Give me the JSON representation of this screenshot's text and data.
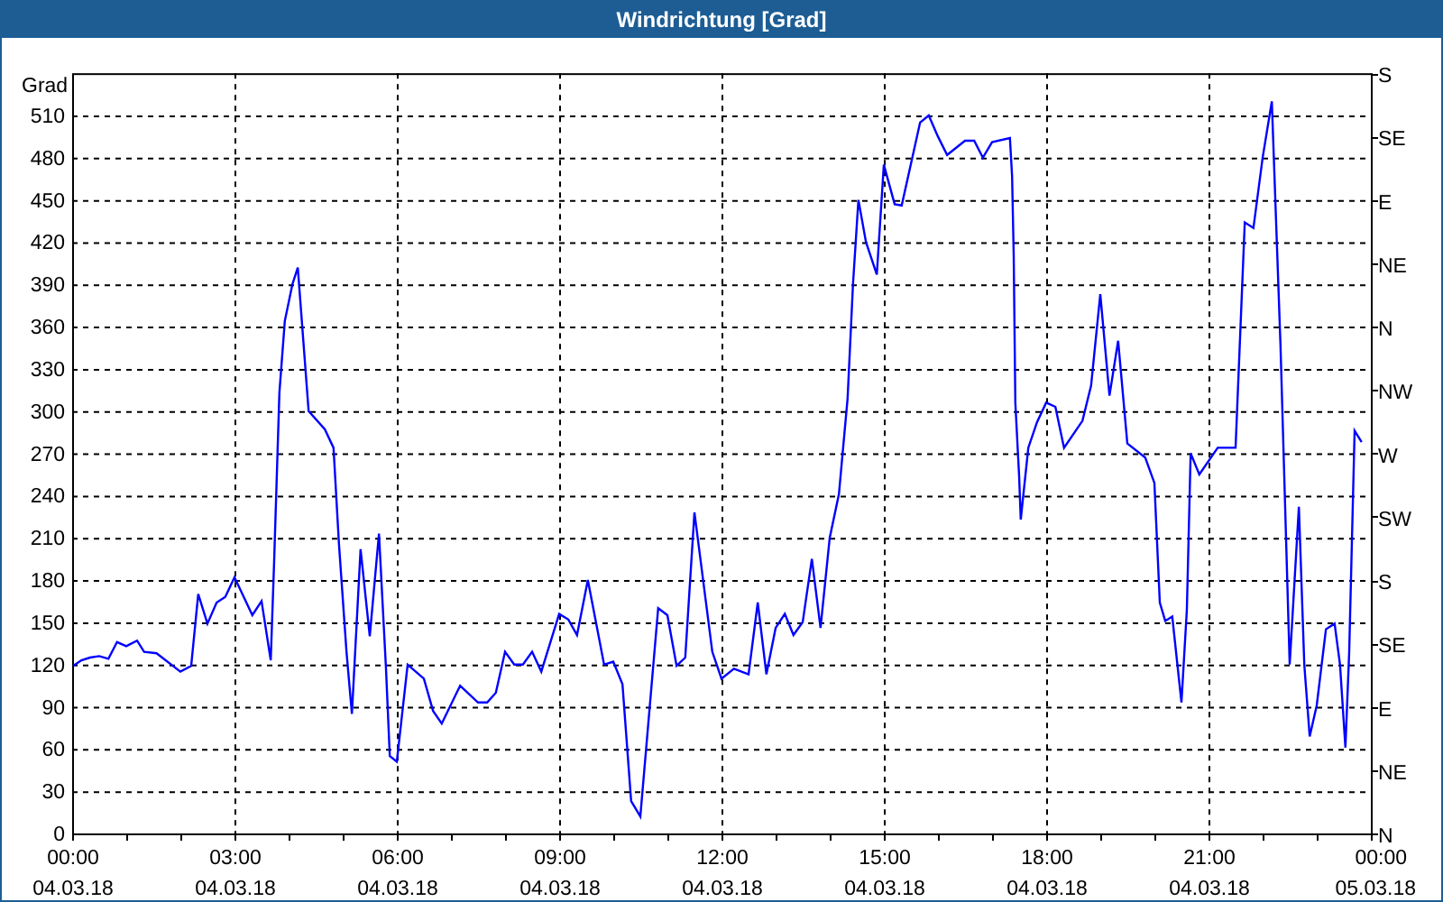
{
  "window": {
    "title": "Windrichtung [Grad]"
  },
  "chart": {
    "chart_data": {
      "type": "line",
      "grid": true,
      "ylabel": "Grad",
      "xlim": [
        0,
        24
      ],
      "ylim": [
        0,
        540
      ],
      "yticks": [
        0,
        30,
        60,
        90,
        120,
        150,
        180,
        210,
        240,
        270,
        300,
        330,
        360,
        390,
        420,
        450,
        480,
        510
      ],
      "xticks": [
        {
          "value": 0,
          "label": "00:00"
        },
        {
          "value": 3,
          "label": "03:00"
        },
        {
          "value": 6,
          "label": "06:00"
        },
        {
          "value": 9,
          "label": "09:00"
        },
        {
          "value": 12,
          "label": "12:00"
        },
        {
          "value": 15,
          "label": "15:00"
        },
        {
          "value": 18,
          "label": "18:00"
        },
        {
          "value": 21,
          "label": "21:00"
        },
        {
          "value": 24,
          "label": "00:00"
        }
      ],
      "x": [
        0.02,
        0.17,
        0.33,
        0.5,
        0.67,
        0.83,
        1.0,
        1.2,
        1.33,
        1.56,
        2.0,
        2.2,
        2.33,
        2.5,
        2.67,
        2.83,
        3.0,
        3.33,
        3.5,
        3.67,
        3.73,
        3.83,
        3.93,
        4.07,
        4.17,
        4.37,
        4.67,
        4.83,
        4.93,
        5.07,
        5.17,
        5.33,
        5.5,
        5.67,
        5.8,
        5.87,
        6.0,
        6.2,
        6.5,
        6.67,
        6.83,
        7.17,
        7.5,
        7.67,
        7.83,
        8.0,
        8.17,
        8.33,
        8.5,
        8.67,
        9.0,
        9.17,
        9.33,
        9.53,
        9.83,
        10.0,
        10.17,
        10.33,
        10.5,
        10.83,
        11.0,
        11.17,
        11.33,
        11.5,
        11.83,
        12.0,
        12.23,
        12.5,
        12.67,
        12.83,
        13.0,
        13.17,
        13.33,
        13.5,
        13.67,
        13.83,
        14.0,
        14.17,
        14.33,
        14.43,
        14.53,
        14.67,
        14.87,
        15.0,
        15.2,
        15.33,
        15.67,
        15.83,
        16.0,
        16.17,
        16.5,
        16.67,
        16.83,
        17.0,
        17.33,
        17.37,
        17.4,
        17.43,
        17.5,
        17.53,
        17.67,
        17.83,
        18.0,
        18.17,
        18.33,
        18.67,
        18.83,
        19.0,
        19.17,
        19.33,
        19.5,
        19.83,
        20.0,
        20.1,
        20.2,
        20.33,
        20.5,
        20.6,
        20.67,
        20.83,
        21.17,
        21.5,
        21.67,
        21.83,
        22.0,
        22.17,
        22.33,
        22.5,
        22.67,
        22.77,
        22.87,
        23.0,
        23.17,
        23.33,
        23.43,
        23.53,
        23.6,
        23.7,
        23.83
      ],
      "series": [
        {
          "color": "#0000ff",
          "values": [
            119,
            123,
            125,
            126,
            124,
            136,
            133,
            137,
            129,
            128,
            115,
            119,
            170,
            149,
            164,
            168,
            182,
            155,
            165,
            123,
            190,
            313,
            364,
            390,
            402,
            300,
            287,
            274,
            206,
            129,
            85,
            202,
            140,
            213,
            117,
            55,
            51,
            120,
            110,
            87,
            78,
            105,
            93,
            93,
            100,
            129,
            120,
            120,
            129,
            115,
            156,
            152,
            141,
            180,
            120,
            122,
            106,
            23,
            12,
            160,
            155,
            119,
            125,
            228,
            129,
            110,
            117,
            113,
            164,
            113,
            146,
            156,
            141,
            150,
            195,
            146,
            210,
            241,
            309,
            390,
            450,
            420,
            397,
            475,
            447,
            446,
            505,
            510,
            495,
            482,
            492,
            492,
            480,
            491,
            494,
            467,
            411,
            306,
            254,
            223,
            274,
            292,
            306,
            303,
            274,
            293,
            318,
            383,
            311,
            350,
            277,
            267,
            249,
            164,
            151,
            154,
            93,
            159,
            270,
            255,
            274,
            274,
            434,
            430,
            480,
            520,
            347,
            120,
            232,
            120,
            69,
            91,
            145,
            149,
            120,
            61,
            129,
            286,
            278
          ]
        }
      ]
    },
    "x_axis_dates": [
      "04.03.18",
      "04.03.18",
      "04.03.18",
      "04.03.18",
      "04.03.18",
      "04.03.18",
      "04.03.18",
      "04.03.18",
      "05.03.18"
    ],
    "right_axis_labels": [
      "S",
      "SE",
      "E",
      "NE",
      "N",
      "NW",
      "W",
      "SW",
      "S",
      "SE",
      "E",
      "NE",
      "N"
    ]
  }
}
